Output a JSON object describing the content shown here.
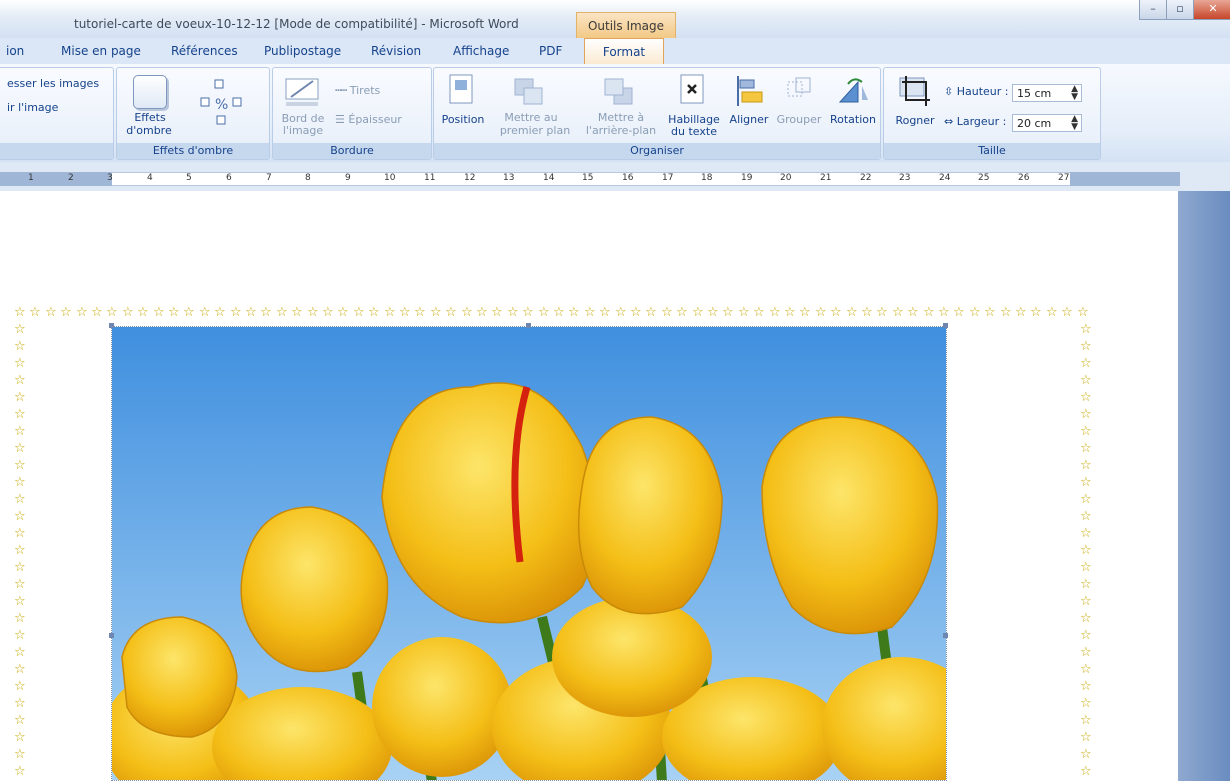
{
  "window": {
    "title": "tutoriel-carte de voeux-10-12-12 [Mode de compatibilité] - Microsoft Word",
    "context_tab": "Outils Image",
    "controls": [
      "minimize-icon",
      "maximize-icon",
      "close-icon"
    ]
  },
  "tabs": [
    {
      "label": "ion"
    },
    {
      "label": "Mise en page"
    },
    {
      "label": "Références"
    },
    {
      "label": "Publipostage"
    },
    {
      "label": "Révision"
    },
    {
      "label": "Affichage"
    },
    {
      "label": "PDF"
    },
    {
      "label": "Format",
      "active": true
    }
  ],
  "ribbon": {
    "adjust": {
      "item1": "esser les images",
      "item2": "ir l'image"
    },
    "shadow": {
      "button": "Effets",
      "button2": "d'ombre",
      "group": "Effets d'ombre"
    },
    "border": {
      "bord": "Bord de",
      "bord2": "l'image",
      "tirets": "Tirets",
      "epaisseur": "Épaisseur",
      "group": "Bordure"
    },
    "arrange": {
      "position": "Position",
      "front1": "Mettre au",
      "front2": "premier plan",
      "back1": "Mettre à",
      "back2": "l'arrière-plan",
      "wrap1": "Habillage",
      "wrap2": "du texte",
      "align": "Aligner",
      "group_btn": "Grouper",
      "rotate": "Rotation",
      "group": "Organiser"
    },
    "size": {
      "crop": "Rogner",
      "height_label": "Hauteur :",
      "height_value": "15 cm",
      "width_label": "Largeur :",
      "width_value": "20 cm",
      "group": "Taille"
    }
  },
  "ruler": {
    "ticks": [
      "1",
      "2",
      "3",
      "4",
      "5",
      "6",
      "7",
      "8",
      "9",
      "10",
      "11",
      "12",
      "13",
      "14",
      "15",
      "16",
      "17",
      "18",
      "19",
      "20",
      "21",
      "22",
      "23",
      "24",
      "25",
      "26",
      "27"
    ]
  },
  "document": {
    "border_glyph": "☆",
    "image_description": "yellow-tulips-photo"
  },
  "colors": {
    "ribbon_text": "#15428b",
    "format_tab_accent": "#e0a45a",
    "star": "#c8a800",
    "sky": "#4a9be4",
    "tulip": "#f5c218"
  }
}
